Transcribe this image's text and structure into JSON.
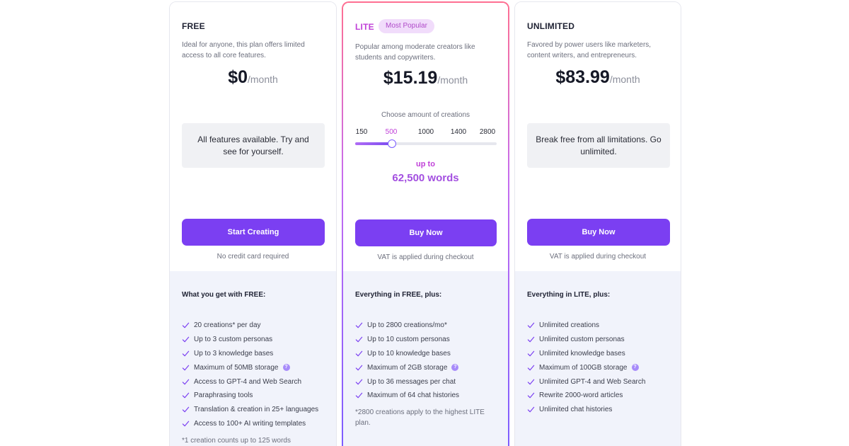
{
  "plans": [
    {
      "name": "FREE",
      "description": "Ideal for anyone, this plan offers limited access to all core features.",
      "price": "$0",
      "period": "/month",
      "info": "All features available. Try and see for yourself.",
      "cta": "Start Creating",
      "note": "No credit card required",
      "features_heading": "What you get with FREE:",
      "features": [
        {
          "text": "20 creations* per day",
          "help": false
        },
        {
          "text": "Up to 3 custom personas",
          "help": false
        },
        {
          "text": "Up to 3 knowledge bases",
          "help": false
        },
        {
          "text": "Maximum of 50MB storage",
          "help": true
        },
        {
          "text": "Access to GPT-4 and Web Search",
          "help": false
        },
        {
          "text": "Paraphrasing tools",
          "help": false
        },
        {
          "text": "Translation & creation in 25+ languages",
          "help": false
        },
        {
          "text": "Access to 100+ AI writing templates",
          "help": false
        }
      ],
      "footnote": "*1 creation counts up to 125 words"
    },
    {
      "name": "LITE",
      "badge": "Most Popular",
      "description": "Popular among moderate creators like students and copywriters.",
      "price": "$15.19",
      "period": "/month",
      "slider": {
        "label": "Choose amount of creations",
        "options": [
          "150",
          "500",
          "1000",
          "1400",
          "2800"
        ],
        "selected_index": 1,
        "level": 0.26,
        "result_prefix": "up to",
        "result": "62,500 words"
      },
      "cta": "Buy Now",
      "note": "VAT is applied during checkout",
      "features_heading": "Everything in FREE, plus:",
      "features": [
        {
          "text": "Up to 2800 creations/mo*",
          "help": false
        },
        {
          "text": "Up to 10 custom personas",
          "help": false
        },
        {
          "text": "Up to 10 knowledge bases",
          "help": false
        },
        {
          "text": "Maximum of 2GB storage",
          "help": true
        },
        {
          "text": "Up to 36 messages per chat",
          "help": false
        },
        {
          "text": "Maximum of 64 chat histories",
          "help": false
        }
      ],
      "footnote": "*2800 creations apply to the highest LITE plan."
    },
    {
      "name": "UNLIMITED",
      "description": "Favored by power users like marketers, content writers, and entrepreneurs.",
      "price": "$83.99",
      "period": "/month",
      "info": "Break free from all limitations. Go unlimited.",
      "cta": "Buy Now",
      "note": "VAT is applied during checkout",
      "features_heading": "Everything in LITE, plus:",
      "features": [
        {
          "text": "Unlimited creations",
          "help": false
        },
        {
          "text": "Unlimited custom personas",
          "help": false
        },
        {
          "text": "Unlimited knowledge bases",
          "help": false
        },
        {
          "text": "Maximum of 100GB storage",
          "help": true
        },
        {
          "text": "Unlimited GPT-4 and Web Search",
          "help": false
        },
        {
          "text": "Rewrite 2000-word articles",
          "help": false
        },
        {
          "text": "Unlimited chat histories",
          "help": false
        }
      ]
    }
  ],
  "help_glyph": "?",
  "colors": {
    "accent": "#7b3ff2",
    "highlight": "#c041d8",
    "features_bg": "#f1f3fb"
  },
  "icons": {
    "check": "check-icon",
    "help": "help-icon"
  }
}
